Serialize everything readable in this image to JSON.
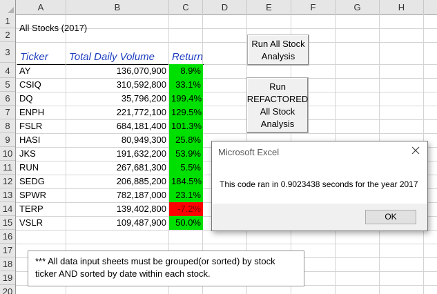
{
  "columns": [
    "A",
    "B",
    "C",
    "D",
    "E",
    "F",
    "G",
    "H"
  ],
  "rows": [
    "1",
    "2",
    "3",
    "4",
    "5",
    "6",
    "7",
    "8",
    "9",
    "10",
    "11",
    "12",
    "13",
    "14",
    "15",
    "16",
    "17",
    "18",
    "19",
    "20"
  ],
  "sheet": {
    "title": "All Stocks (2017)",
    "headers": {
      "ticker": "Ticker",
      "volume": "Total Daily Volume",
      "return": "Return"
    },
    "data": [
      {
        "ticker": "AY",
        "volume": "136,070,900",
        "return": "8.9%",
        "status": "positive"
      },
      {
        "ticker": "CSIQ",
        "volume": "310,592,800",
        "return": "33.1%",
        "status": "positive"
      },
      {
        "ticker": "DQ",
        "volume": "35,796,200",
        "return": "199.4%",
        "status": "positive"
      },
      {
        "ticker": "ENPH",
        "volume": "221,772,100",
        "return": "129.5%",
        "status": "positive"
      },
      {
        "ticker": "FSLR",
        "volume": "684,181,400",
        "return": "101.3%",
        "status": "positive"
      },
      {
        "ticker": "HASI",
        "volume": "80,949,300",
        "return": "25.8%",
        "status": "positive"
      },
      {
        "ticker": "JKS",
        "volume": "191,632,200",
        "return": "53.9%",
        "status": "positive"
      },
      {
        "ticker": "RUN",
        "volume": "267,681,300",
        "return": "5.5%",
        "status": "positive"
      },
      {
        "ticker": "SEDG",
        "volume": "206,885,200",
        "return": "184.5%",
        "status": "positive"
      },
      {
        "ticker": "SPWR",
        "volume": "782,187,000",
        "return": "23.1%",
        "status": "positive"
      },
      {
        "ticker": "TERP",
        "volume": "139,402,800",
        "return": "-7.2%",
        "status": "negative"
      },
      {
        "ticker": "VSLR",
        "volume": "109,487,900",
        "return": "50.0%",
        "status": "positive"
      }
    ]
  },
  "buttons": {
    "run_all": [
      "Run All Stock",
      "Analysis"
    ],
    "run_refactored": [
      "Run",
      "REFACTORED",
      "All Stock",
      "Analysis"
    ]
  },
  "note": {
    "line1": "***  All data input sheets must be grouped(or sorted) by stock",
    "line2": "ticker AND sorted by date within each stock."
  },
  "dialog": {
    "title": "Microsoft Excel",
    "message": "This code ran in 0.9023438 seconds for the year 2017",
    "ok_label": "OK",
    "close_icon": "close-icon"
  },
  "colors": {
    "positive": "#00e000",
    "negative": "#ff0000",
    "header_text": "#1f3fbf"
  }
}
